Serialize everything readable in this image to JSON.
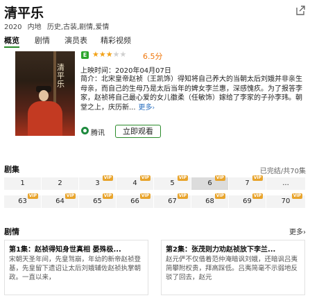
{
  "header": {
    "title": "清平乐",
    "meta": [
      "2020",
      "内地",
      "历史,古装,剧情,爱情"
    ]
  },
  "tabs": [
    {
      "label": "概览",
      "active": true
    },
    {
      "label": "剧情",
      "active": false
    },
    {
      "label": "演员表",
      "active": false
    },
    {
      "label": "精彩视频",
      "active": false
    }
  ],
  "poster": {
    "logo_text": "清平乐"
  },
  "rating": {
    "badge": "E",
    "stars": 3,
    "max_stars": 5,
    "score": "6.5分"
  },
  "airtime": "上映时间：2020年04月07日",
  "synopsis": {
    "text": "简介：北宋皇帝赵祯（王凯饰）得知将自己养大的当朝太后刘娥并非亲生母亲，而自己的生母乃是太后当年的婢女李兰惠，深感愧疚。为了报答李家，赵祯将自己最心爱的女儿徽柔（任敏饰）嫁给了李家的子孙李玮。朝堂之上，庆历新...",
    "more": "更多",
    "more_arrow": "›"
  },
  "source": {
    "label": "腾讯",
    "watch_button": "立即观看"
  },
  "episodes": {
    "title": "剧集",
    "status": "已完结/共70集",
    "vip_label": "VIP",
    "row1": [
      {
        "label": "1",
        "vip": false,
        "selected": false
      },
      {
        "label": "2",
        "vip": false,
        "selected": false
      },
      {
        "label": "3",
        "vip": true,
        "selected": false
      },
      {
        "label": "4",
        "vip": true,
        "selected": false
      },
      {
        "label": "5",
        "vip": true,
        "selected": false
      },
      {
        "label": "6",
        "vip": true,
        "selected": true
      },
      {
        "label": "7",
        "vip": true,
        "selected": false
      },
      {
        "label": "...",
        "vip": false,
        "selected": false
      }
    ],
    "row2": [
      {
        "label": "63",
        "vip": true
      },
      {
        "label": "64",
        "vip": true
      },
      {
        "label": "65",
        "vip": true
      },
      {
        "label": "66",
        "vip": true
      },
      {
        "label": "67",
        "vip": true
      },
      {
        "label": "68",
        "vip": true
      },
      {
        "label": "69",
        "vip": true
      },
      {
        "label": "70",
        "vip": true
      }
    ]
  },
  "plot": {
    "title": "剧情",
    "more": "更多",
    "more_arrow": "›",
    "cards": [
      {
        "title": "第1集：赵祯得知身世真相 晏殊极...",
        "body": "宋朝天圣年间，先皇驾崩，年幼的新帝赵祯登基，先皇留下遗诏让太后刘娥辅佐赵祯执掌朝政。一直以来，"
      },
      {
        "title": "第2集：张茂则力劝赵祯放下李兰...",
        "body": "赵元俨不仅借着范仲淹暗讽刘娥，还暗讽吕夷简攀附权贵，拜高踩低。吕夷简毫不示弱地反驳了回去，赵元"
      }
    ]
  }
}
